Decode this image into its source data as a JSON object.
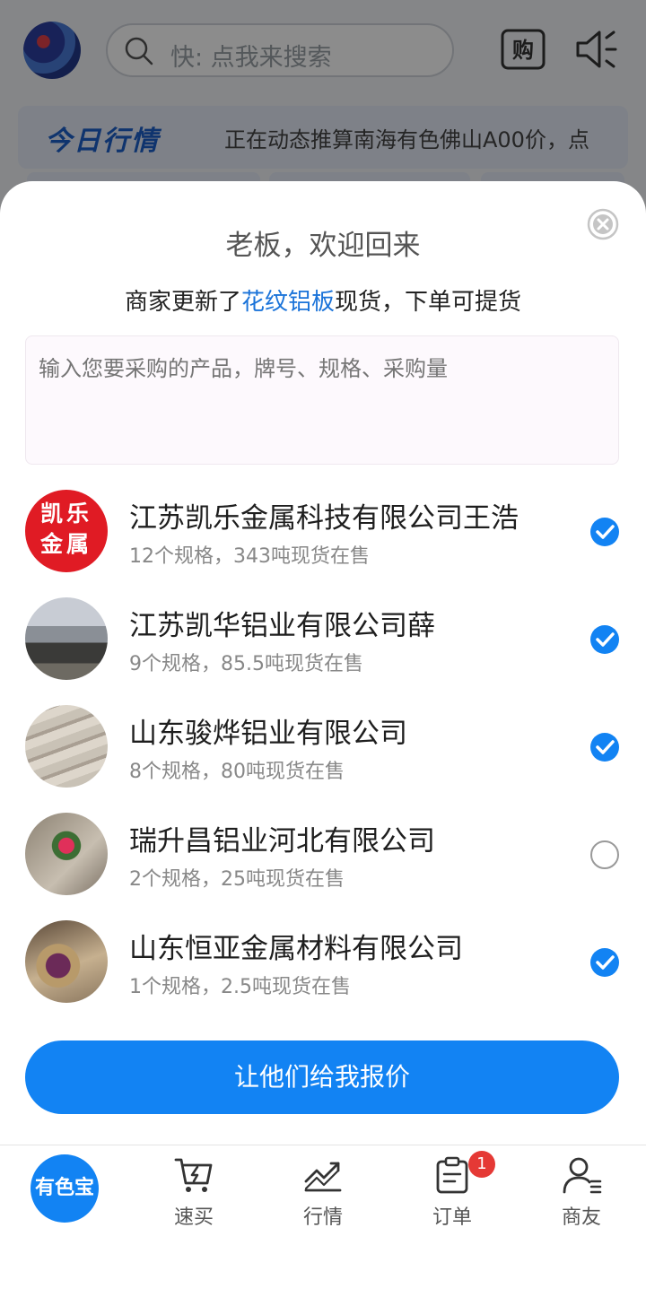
{
  "header": {
    "search_placeholder": "快: 点我来搜索",
    "buy_icon_label": "购"
  },
  "market": {
    "title": "今日行情",
    "ticker": "正在动态推算南海有色佛山A00价，点"
  },
  "modal": {
    "title": "老板，欢迎回来",
    "subtitle_prefix": "商家更新了",
    "subtitle_highlight": "花纹铝板",
    "subtitle_suffix": "现货，下单可提货",
    "input_placeholder": "输入您要采购的产品，牌号、规格、采购量",
    "submit_label": "让他们给我报价"
  },
  "suppliers": [
    {
      "name": "江苏凯乐金属科技有限公司王浩",
      "meta": "12个规格，343吨现货在售",
      "avatar_text_1": "凯乐",
      "avatar_text_2": "金属",
      "selected": true
    },
    {
      "name": "江苏凯华铝业有限公司薛",
      "meta": "9个规格，85.5吨现货在售",
      "selected": true
    },
    {
      "name": "山东骏烨铝业有限公司",
      "meta": "8个规格，80吨现货在售",
      "selected": true
    },
    {
      "name": "瑞升昌铝业河北有限公司",
      "meta": "2个规格，25吨现货在售",
      "selected": false
    },
    {
      "name": "山东恒亚金属材料有限公司",
      "meta": "1个规格，2.5吨现货在售",
      "selected": true
    }
  ],
  "nav": {
    "home": "有色宝",
    "items": [
      {
        "label": "速买",
        "icon": "cart-bolt-icon"
      },
      {
        "label": "行情",
        "icon": "trend-chart-icon"
      },
      {
        "label": "订单",
        "icon": "clipboard-icon"
      },
      {
        "label": "商友",
        "icon": "contacts-icon"
      }
    ],
    "order_badge": "1"
  },
  "colors": {
    "accent": "#1283f3",
    "highlight": "#1a73d9",
    "badge": "#e53935"
  }
}
